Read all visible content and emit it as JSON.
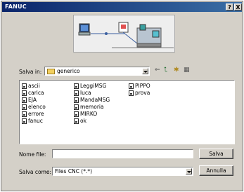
{
  "window": {
    "title": "FANUC",
    "help_label": "?",
    "close_label": "X"
  },
  "save_in": {
    "label": "Salva in:",
    "folder": "generico"
  },
  "files": [
    [
      "ascii",
      "carica",
      "EJA",
      "elenco",
      "errore",
      "fanuc"
    ],
    [
      "LeggiMSG",
      "luca",
      "MandaMSG",
      "memoria",
      "MIRKO",
      "ok"
    ],
    [
      "PIPPO",
      "prova"
    ]
  ],
  "filename": {
    "label": "Nome file:",
    "value": ""
  },
  "filetype": {
    "label": "Salva come:",
    "value": "Files CNC (*.*)"
  },
  "buttons": {
    "save": "Salva",
    "cancel": "Annulla"
  },
  "toolbar": {
    "back": "⇐",
    "up": "⮤",
    "new_folder": "✱",
    "views": "▦"
  }
}
